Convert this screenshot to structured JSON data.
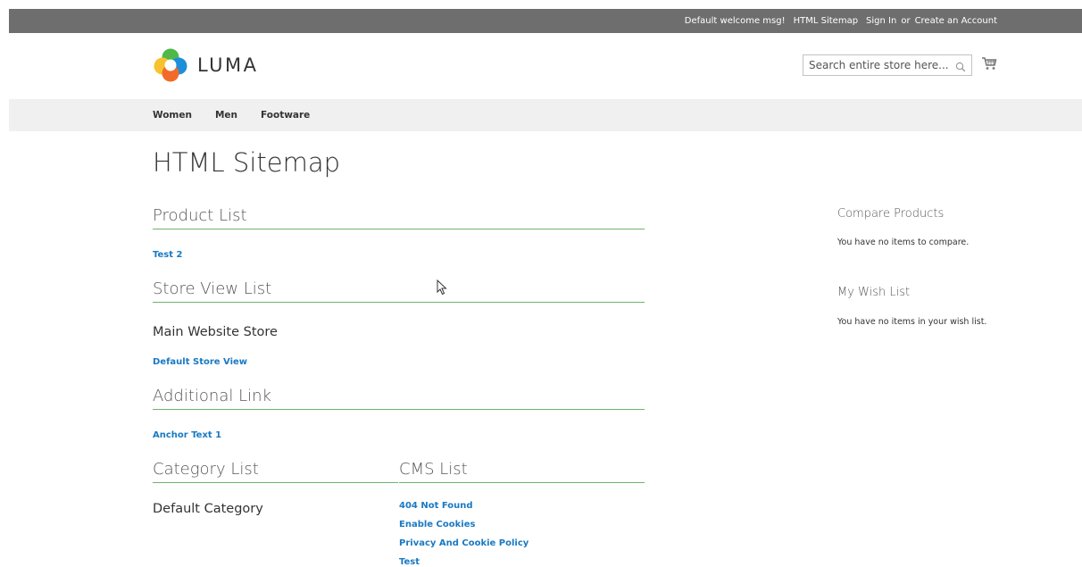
{
  "topbar": {
    "welcome": "Default welcome msg!",
    "html_sitemap": "HTML Sitemap",
    "sign_in": "Sign In",
    "or": "or",
    "create_account": "Create an Account"
  },
  "header": {
    "logo_text": "LUMA",
    "search_placeholder": "Search entire store here...",
    "search_icon": "search-icon",
    "cart_icon": "cart-icon"
  },
  "nav": {
    "items": [
      "Women",
      "Men",
      "Footware"
    ]
  },
  "page": {
    "title": "HTML Sitemap"
  },
  "sections": {
    "product_list": {
      "title": "Product List",
      "links": [
        "Test 2"
      ]
    },
    "store_view_list": {
      "title": "Store View List",
      "store_name": "Main Website Store",
      "links": [
        "Default Store View"
      ]
    },
    "additional_link": {
      "title": "Additional Link",
      "links": [
        "Anchor Text 1"
      ]
    },
    "category_list": {
      "title": "Category List",
      "items": [
        "Default Category"
      ]
    },
    "cms_list": {
      "title": "CMS List",
      "links": [
        "404 Not Found",
        "Enable Cookies",
        "Privacy And Cookie Policy",
        "Test"
      ]
    }
  },
  "sidebar": {
    "compare": {
      "title": "Compare Products",
      "text": "You have no items to compare."
    },
    "wishlist": {
      "title": "My Wish List",
      "text": "You have no items in your wish list."
    }
  },
  "colors": {
    "topbar_bg": "#6e6e6e",
    "nav_bg": "#f0f0f0",
    "link": "#1979c3",
    "divider": "#6db36d"
  }
}
